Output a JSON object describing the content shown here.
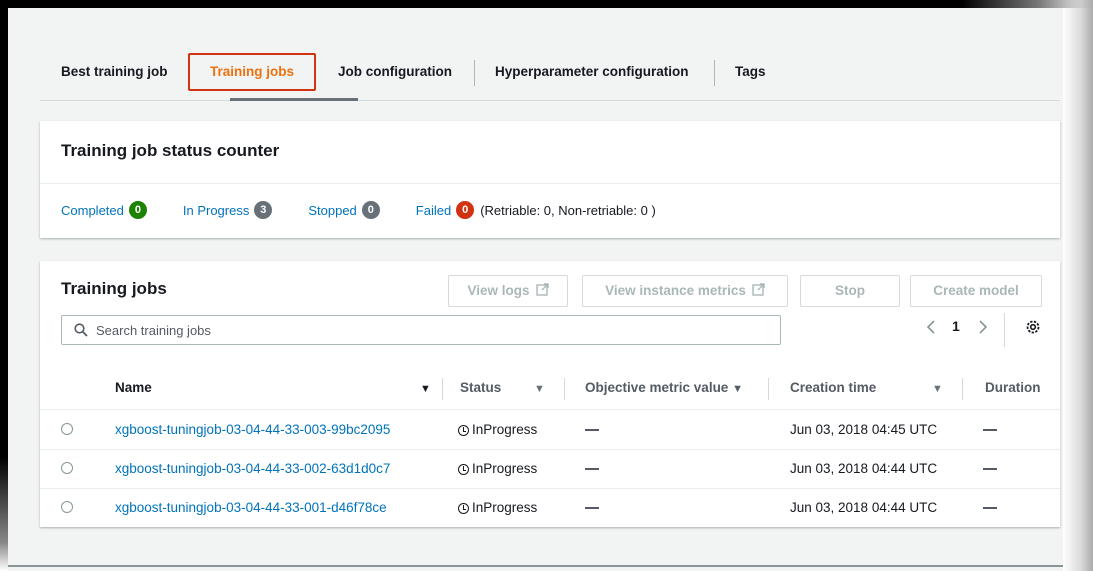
{
  "tabs": [
    {
      "label": "Best training job"
    },
    {
      "label": "Training jobs"
    },
    {
      "label": "Job configuration"
    },
    {
      "label": "Hyperparameter configuration"
    },
    {
      "label": "Tags"
    }
  ],
  "counter": {
    "title": "Training job status counter",
    "completed": {
      "label": "Completed",
      "count": "0"
    },
    "in_progress": {
      "label": "In Progress",
      "count": "3"
    },
    "stopped": {
      "label": "Stopped",
      "count": "0"
    },
    "failed": {
      "label": "Failed",
      "count": "0",
      "note": "(Retriable: 0, Non-retriable: 0 )"
    }
  },
  "jobs": {
    "title": "Training jobs",
    "buttons": {
      "view_logs": "View logs",
      "view_metrics": "View instance metrics",
      "stop": "Stop",
      "create_model": "Create model"
    },
    "search": {
      "placeholder": "Search training jobs"
    },
    "pager": {
      "page": "1"
    },
    "columns": {
      "name": "Name",
      "status": "Status",
      "objective": "Objective metric value",
      "creation": "Creation time",
      "duration": "Duration"
    },
    "rows": [
      {
        "name": "xgboost-tuningjob-03-04-44-33-003-99bc2095",
        "status": "InProgress",
        "creation": "Jun 03, 2018 04:45 UTC"
      },
      {
        "name": "xgboost-tuningjob-03-04-44-33-002-63d1d0c7",
        "status": "InProgress",
        "creation": "Jun 03, 2018 04:44 UTC"
      },
      {
        "name": "xgboost-tuningjob-03-04-44-33-001-d46f78ce",
        "status": "InProgress",
        "creation": "Jun 03, 2018 04:44 UTC"
      }
    ]
  },
  "colors": {
    "accent": "#ec7211",
    "link": "#0073bb",
    "completed": "#1d8102",
    "failed": "#d13212",
    "neutral": "#687078"
  },
  "icons": [
    "external-link-icon",
    "search-icon",
    "chevron-left-icon",
    "chevron-right-icon",
    "settings-icon",
    "sort-caret-icon",
    "clock-icon"
  ]
}
